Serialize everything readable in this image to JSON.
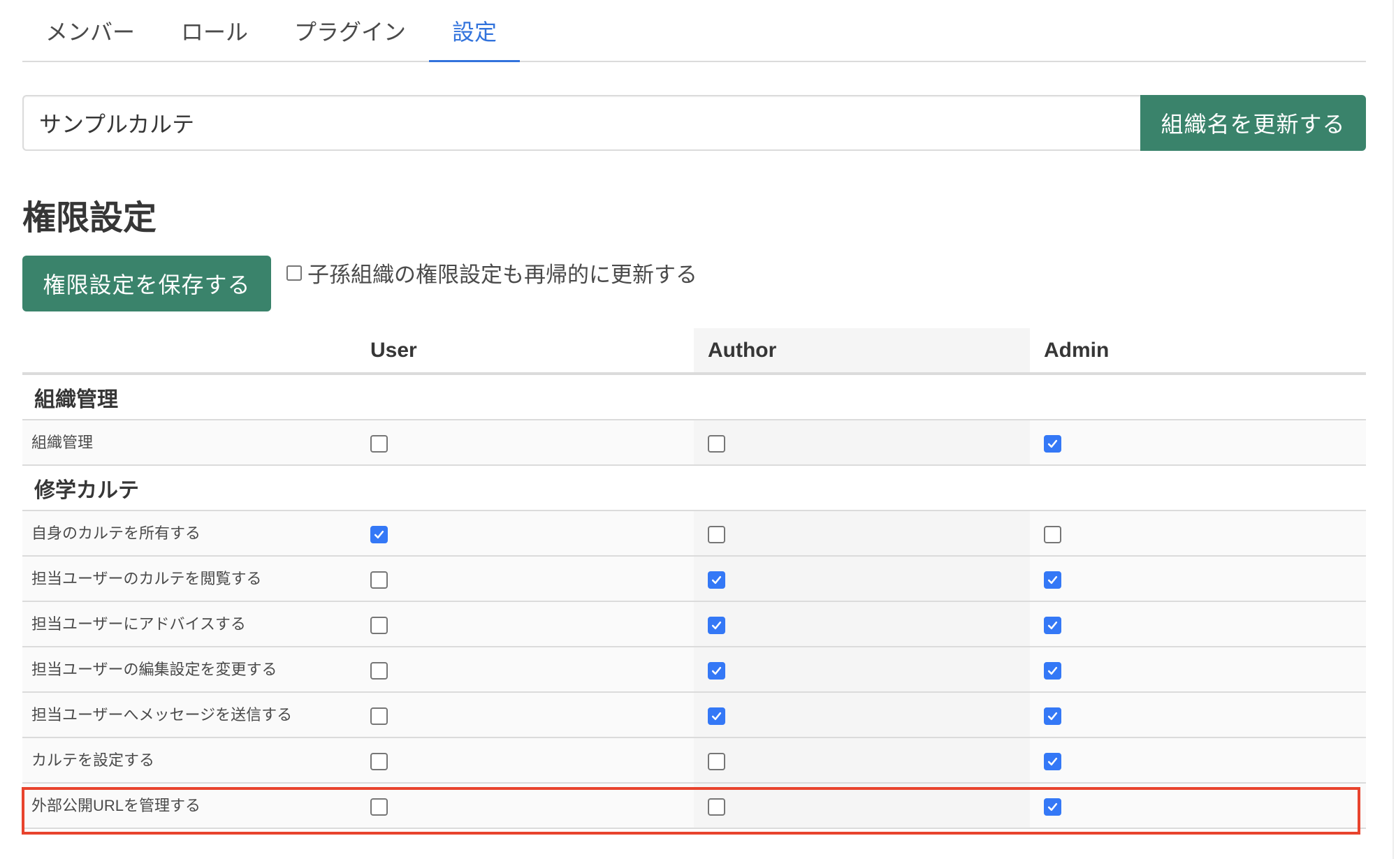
{
  "tabs": [
    {
      "label": "メンバー",
      "active": false
    },
    {
      "label": "ロール",
      "active": false
    },
    {
      "label": "プラグイン",
      "active": false
    },
    {
      "label": "設定",
      "active": true
    }
  ],
  "org": {
    "name_value": "サンプルカルテ",
    "update_button": "組織名を更新する"
  },
  "permissions": {
    "heading": "権限設定",
    "save_button": "権限設定を保存する",
    "recursive_label": "子孫組織の権限設定も再帰的に更新する",
    "recursive_checked": false,
    "columns": [
      "",
      "User",
      "Author",
      "Admin"
    ],
    "sections": [
      {
        "title": "組織管理",
        "rows": [
          {
            "label": "組織管理",
            "user": false,
            "author": false,
            "admin": true
          }
        ]
      },
      {
        "title": "修学カルテ",
        "rows": [
          {
            "label": "自身のカルテを所有する",
            "user": true,
            "author": false,
            "admin": false
          },
          {
            "label": "担当ユーザーのカルテを閲覧する",
            "user": false,
            "author": true,
            "admin": true
          },
          {
            "label": "担当ユーザーにアドバイスする",
            "user": false,
            "author": true,
            "admin": true
          },
          {
            "label": "担当ユーザーの編集設定を変更する",
            "user": false,
            "author": true,
            "admin": true
          },
          {
            "label": "担当ユーザーへメッセージを送信する",
            "user": false,
            "author": true,
            "admin": true
          },
          {
            "label": "カルテを設定する",
            "user": false,
            "author": false,
            "admin": true
          },
          {
            "label": "外部公開URLを管理する",
            "user": false,
            "author": false,
            "admin": true,
            "highlighted": true
          }
        ]
      }
    ]
  },
  "colors": {
    "accent_green": "#3a836b",
    "tab_active": "#3273dc",
    "checkbox_checked": "#3478f6",
    "highlight_border": "#e8432d"
  }
}
